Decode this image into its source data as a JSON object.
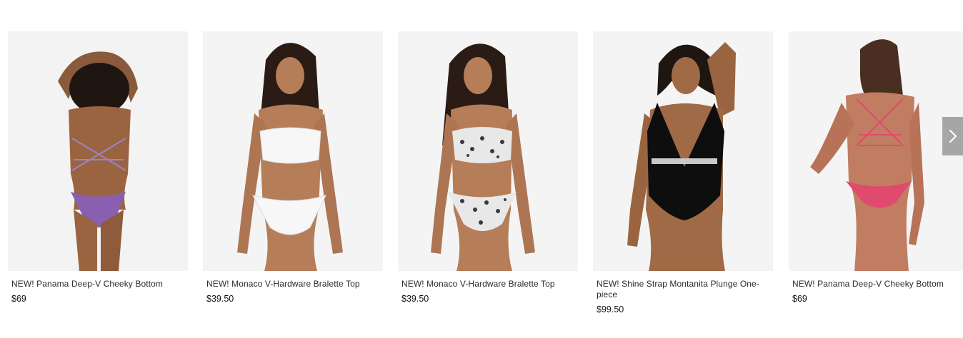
{
  "products": [
    {
      "name": "NEW! Panama Deep-V Cheeky Bottom",
      "price": "$69",
      "swimsuit_color": "#8a5fb0",
      "pose": "back"
    },
    {
      "name": "NEW! Monaco V-Hardware Bralette Top",
      "price": "$39.50",
      "swimsuit_color": "#f7f7f7",
      "pose": "front"
    },
    {
      "name": "NEW! Monaco V-Hardware Bralette Top",
      "price": "$39.50",
      "swimsuit_color": "#3a3a3a",
      "pose": "front"
    },
    {
      "name": "NEW! Shine Strap Montanita Plunge One-piece",
      "price": "$99.50",
      "swimsuit_color": "#0e0e0e",
      "pose": "front"
    },
    {
      "name": "NEW! Panama Deep-V Cheeky Bottom",
      "price": "$69",
      "swimsuit_color": "#e04a6e",
      "pose": "back"
    }
  ],
  "navigation": {
    "next_icon": "chevron-right-icon"
  }
}
